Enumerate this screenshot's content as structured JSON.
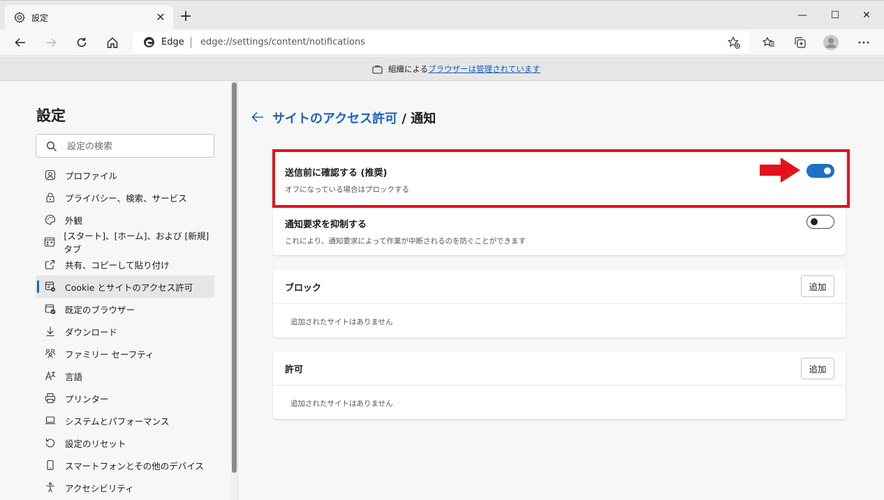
{
  "browser": {
    "tab_title": "設定",
    "new_tab": "+",
    "window_controls": {
      "minimize": "—",
      "maximize": "☐",
      "close": "✕"
    },
    "omnibox": {
      "site_label": "Edge",
      "url": "edge://settings/content/notifications"
    }
  },
  "managed_banner": {
    "prefix": "組織による",
    "link": "ブラウザーは管理されています"
  },
  "sidebar": {
    "title": "設定",
    "search_placeholder": "設定の検索",
    "items": [
      {
        "label": "プロファイル",
        "icon": "profile-icon"
      },
      {
        "label": "プライバシー、検索、サービス",
        "icon": "lock-icon"
      },
      {
        "label": "外観",
        "icon": "palette-icon"
      },
      {
        "label": "[スタート]、[ホーム]、および [新規] タブ",
        "icon": "home-grid-icon"
      },
      {
        "label": "共有、コピーして貼り付け",
        "icon": "share-icon"
      },
      {
        "label": "Cookie とサイトのアクセス許可",
        "icon": "site-permissions-icon",
        "active": true
      },
      {
        "label": "既定のブラウザー",
        "icon": "default-browser-icon"
      },
      {
        "label": "ダウンロード",
        "icon": "download-icon"
      },
      {
        "label": "ファミリー セーフティ",
        "icon": "family-icon"
      },
      {
        "label": "言語",
        "icon": "language-icon"
      },
      {
        "label": "プリンター",
        "icon": "printer-icon"
      },
      {
        "label": "システムとパフォーマンス",
        "icon": "laptop-icon"
      },
      {
        "label": "設定のリセット",
        "icon": "reset-icon"
      },
      {
        "label": "スマートフォンとその他のデバイス",
        "icon": "phone-icon"
      },
      {
        "label": "アクセシビリティ",
        "icon": "accessibility-icon"
      }
    ]
  },
  "main": {
    "breadcrumb_parent": "サイトのアクセス許可",
    "breadcrumb_sep": "/",
    "breadcrumb_current": "通知",
    "settings": [
      {
        "title": "送信前に確認する (推奨)",
        "desc": "オフになっている場合はブロックする",
        "toggle_on": true
      },
      {
        "title": "通知要求を抑制する",
        "desc": "これにより、通知要求によって作業が中断されるのを防ぐことができます",
        "toggle_on": false
      }
    ],
    "block": {
      "title": "ブロック",
      "add": "追加",
      "empty": "追加されたサイトはありません"
    },
    "allow": {
      "title": "許可",
      "add": "追加",
      "empty": "追加されたサイトはありません"
    }
  },
  "colors": {
    "accent": "#1f6fc6",
    "highlight": "#e3121b",
    "link": "#1a63b6"
  }
}
